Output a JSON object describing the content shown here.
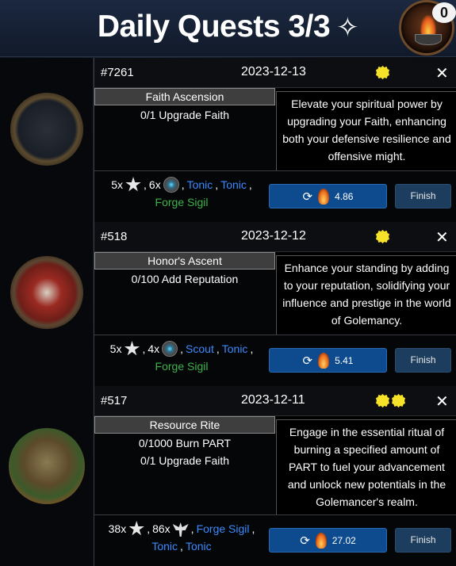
{
  "header": {
    "title": "Daily Quests 3/3",
    "title_icon": "sparkle-icon",
    "notification_count": "0"
  },
  "quests": [
    {
      "id": "#7261",
      "date": "2023-12-13",
      "stars": 1,
      "name": "Faith Ascension",
      "tasks": [
        "0/1 Upgrade Faith"
      ],
      "description": "Elevate your spiritual power by upgrading your Faith, enhancing both your defensive resilience and offensive might.",
      "rewards": {
        "line1": {
          "a_count": "5x",
          "b_count": "6x",
          "l1": "Tonic",
          "l2": "Tonic"
        },
        "line2": {
          "g": "Forge Sigil"
        }
      },
      "cost": "4.86",
      "finish_label": "Finish"
    },
    {
      "id": "#518",
      "date": "2023-12-12",
      "stars": 1,
      "name": "Honor's Ascent",
      "tasks": [
        "0/100 Add Reputation"
      ],
      "description": "Enhance your standing by adding to your reputation, solidifying your influence and prestige in the world of Golemancy.",
      "rewards": {
        "line1": {
          "a_count": "5x",
          "b_count": "4x",
          "l1": "Scout",
          "l2": "Tonic"
        },
        "line2": {
          "g": "Forge Sigil"
        }
      },
      "cost": "5.41",
      "finish_label": "Finish"
    },
    {
      "id": "#517",
      "date": "2023-12-11",
      "stars": 2,
      "name": "Resource Rite",
      "tasks": [
        "0/1000 Burn PART",
        "0/1 Upgrade Faith"
      ],
      "description": "Engage in the essential ritual of burning a specified amount of PART to fuel your advancement and unlock new potentials in the Golemancer's realm.",
      "rewards": {
        "line1": {
          "a_count": "38x",
          "b_count": "86x",
          "l1": "Forge Sigil"
        },
        "line2": {
          "l2": "Tonic",
          "l3": "Tonic"
        }
      },
      "cost": "27.02",
      "finish_label": "Finish"
    }
  ],
  "colors": {
    "link": "#3a8bff",
    "green": "#3fb24a",
    "button": "#0d4a8e",
    "star": "#f7e22a"
  }
}
